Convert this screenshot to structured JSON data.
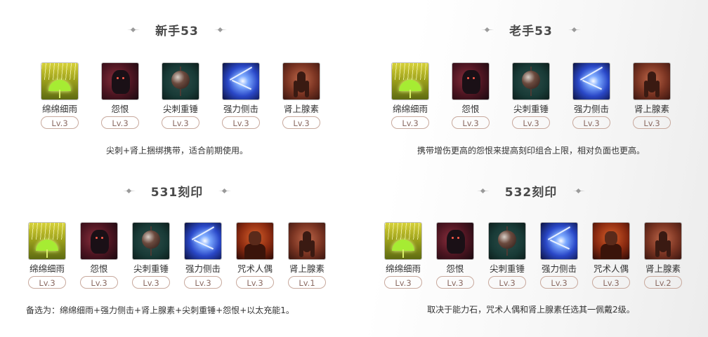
{
  "panels": [
    {
      "title": "新手53",
      "skills": [
        {
          "name": "绵绵细雨",
          "level": "Lv.3",
          "icon": "rain-umbrella-icon"
        },
        {
          "name": "怨恨",
          "level": "Lv.3",
          "icon": "grudge-beast-icon"
        },
        {
          "name": "尖刺重锤",
          "level": "Lv.3",
          "icon": "spiked-hammer-icon"
        },
        {
          "name": "强力侧击",
          "level": "Lv.3",
          "icon": "lightning-strike-icon"
        },
        {
          "name": "肾上腺素",
          "level": "Lv.3",
          "icon": "adrenaline-runner-icon"
        }
      ],
      "note": "尖刺+肾上捆绑携带，适合前期使用。"
    },
    {
      "title": "老手53",
      "skills": [
        {
          "name": "绵绵细雨",
          "level": "Lv.3",
          "icon": "rain-umbrella-icon"
        },
        {
          "name": "怨恨",
          "level": "Lv.3",
          "icon": "grudge-beast-icon"
        },
        {
          "name": "尖刺重锤",
          "level": "Lv.3",
          "icon": "spiked-hammer-icon"
        },
        {
          "name": "强力侧击",
          "level": "Lv.3",
          "icon": "lightning-strike-icon"
        },
        {
          "name": "肾上腺素",
          "level": "Lv.3",
          "icon": "adrenaline-runner-icon"
        }
      ],
      "note": "携带增伤更高的怨恨来提高刻印组合上限，相对负面也更高。"
    },
    {
      "title": "531刻印",
      "skills": [
        {
          "name": "绵绵细雨",
          "level": "Lv.3",
          "icon": "rain-umbrella-icon"
        },
        {
          "name": "怨恨",
          "level": "Lv.3",
          "icon": "grudge-beast-icon"
        },
        {
          "name": "尖刺重锤",
          "level": "Lv.3",
          "icon": "spiked-hammer-icon"
        },
        {
          "name": "强力侧击",
          "level": "Lv.3",
          "icon": "lightning-strike-icon"
        },
        {
          "name": "咒术人偶",
          "level": "Lv.3",
          "icon": "cursed-doll-icon"
        },
        {
          "name": "肾上腺素",
          "level": "Lv.1",
          "icon": "adrenaline-runner-icon"
        }
      ],
      "note": "备选为：绵绵细雨+强力侧击+肾上腺素+尖刺重锤+怨恨+以太充能1。"
    },
    {
      "title": "532刻印",
      "skills": [
        {
          "name": "绵绵细雨",
          "level": "Lv.3",
          "icon": "rain-umbrella-icon"
        },
        {
          "name": "怨恨",
          "level": "Lv.3",
          "icon": "grudge-beast-icon"
        },
        {
          "name": "尖刺重锤",
          "level": "Lv.3",
          "icon": "spiked-hammer-icon"
        },
        {
          "name": "强力侧击",
          "level": "Lv.3",
          "icon": "lightning-strike-icon"
        },
        {
          "name": "咒术人偶",
          "level": "Lv.3",
          "icon": "cursed-doll-icon"
        },
        {
          "name": "肾上腺素",
          "level": "Lv.2",
          "icon": "adrenaline-runner-icon"
        }
      ],
      "note": "取决于能力石，咒术人偶和肾上腺素任选其一佩戴2级。"
    }
  ]
}
